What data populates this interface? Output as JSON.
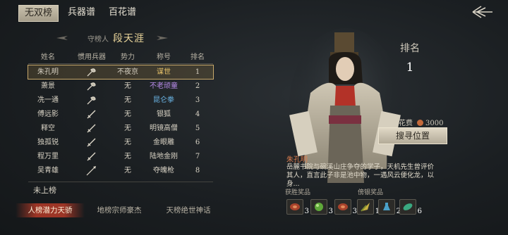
{
  "tabs": [
    "无双榜",
    "兵器谱",
    "百花谱"
  ],
  "guardian": {
    "label": "守榜人",
    "name": "段天涯"
  },
  "table": {
    "headers": [
      "姓名",
      "惯用兵器",
      "势力",
      "称号",
      "排名"
    ],
    "rows": [
      {
        "name": "朱孔明",
        "weapon": "fan",
        "faction": "不夜京",
        "title": "谋世",
        "rank": "1",
        "title_color": "#e8c36a",
        "selected": true
      },
      {
        "name": "萧景",
        "weapon": "fan",
        "faction": "无",
        "title": "不老顽童",
        "rank": "2",
        "title_color": "#b68ae8",
        "selected": false
      },
      {
        "name": "冼一通",
        "weapon": "fan",
        "faction": "无",
        "title": "昆仑拳",
        "rank": "3",
        "title_color": "#6bb6e8",
        "selected": false
      },
      {
        "name": "傅远影",
        "weapon": "sword",
        "faction": "无",
        "title": "银狐",
        "rank": "4",
        "title_color": "#d8d2c4",
        "selected": false
      },
      {
        "name": "释空",
        "weapon": "sword",
        "faction": "无",
        "title": "明镜高僧",
        "rank": "5",
        "title_color": "#d8d2c4",
        "selected": false
      },
      {
        "name": "独孤锐",
        "weapon": "sword",
        "faction": "无",
        "title": "金眼雕",
        "rank": "6",
        "title_color": "#d8d2c4",
        "selected": false
      },
      {
        "name": "程万里",
        "weapon": "sword",
        "faction": "无",
        "title": "陆地金刚",
        "rank": "7",
        "title_color": "#d8d2c4",
        "selected": false
      },
      {
        "name": "吴青雄",
        "weapon": "spear",
        "faction": "无",
        "title": "夺魄枪",
        "rank": "8",
        "title_color": "#d8d2c4",
        "selected": false
      }
    ]
  },
  "not_listed": "未上榜",
  "subtabs": [
    "人榜潜力天骄",
    "地榜宗师豪杰",
    "天榜绝世神话"
  ],
  "rank": {
    "label": "排名",
    "value": "1"
  },
  "cost": {
    "label": "花费",
    "value": "3000"
  },
  "search_button": "搜寻位置",
  "character": {
    "name": "朱孔明",
    "description": "岳麓书院与碗溪山庄争夺的学子，天机先生曾评价其人，直言此子非是池中物，一遇风云便化龙，以身..."
  },
  "defeat_rewards": {
    "label": "获胜奖品",
    "items": [
      {
        "icon": "meat-icon",
        "count": "3"
      },
      {
        "icon": "green-orb-icon",
        "count": "3"
      },
      {
        "icon": "meat-icon",
        "count": "3"
      }
    ]
  },
  "sparring_rewards": {
    "label": "傍银奖品",
    "items": [
      {
        "icon": "yellow-herb-icon",
        "count": "1"
      },
      {
        "icon": "blue-vial-icon",
        "count": "2"
      },
      {
        "icon": "jade-leaf-icon",
        "count": "6"
      }
    ]
  }
}
